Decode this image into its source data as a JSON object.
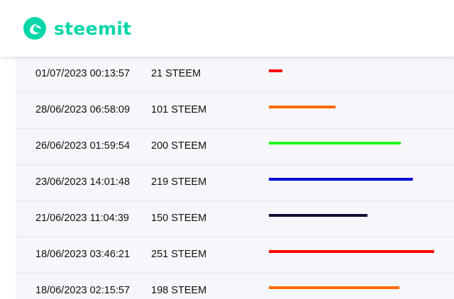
{
  "header": {
    "brand": "steemit",
    "brand_color": "#06d6a9",
    "logo_icon": "steemit-logo-icon"
  },
  "transactions": [
    {
      "date": "01/07/2023 00:13:57",
      "amount": "21 STEEM",
      "value": 21,
      "bar_color": "#ff0000"
    },
    {
      "date": "28/06/2023 06:58:09",
      "amount": "101 STEEM",
      "value": 101,
      "bar_color": "#ff6a00"
    },
    {
      "date": "26/06/2023 01:59:54",
      "amount": "200 STEEM",
      "value": 200,
      "bar_color": "#22ff22"
    },
    {
      "date": "23/06/2023 14:01:48",
      "amount": "219 STEEM",
      "value": 219,
      "bar_color": "#0000dd"
    },
    {
      "date": "21/06/2023 11:04:39",
      "amount": "150 STEEM",
      "value": 150,
      "bar_color": "#111133"
    },
    {
      "date": "18/06/2023 03:46:21",
      "amount": "251 STEEM",
      "value": 251,
      "bar_color": "#ff0000"
    },
    {
      "date": "18/06/2023 02:15:57",
      "amount": "198 STEEM",
      "value": 198,
      "bar_color": "#ff6a00"
    }
  ]
}
